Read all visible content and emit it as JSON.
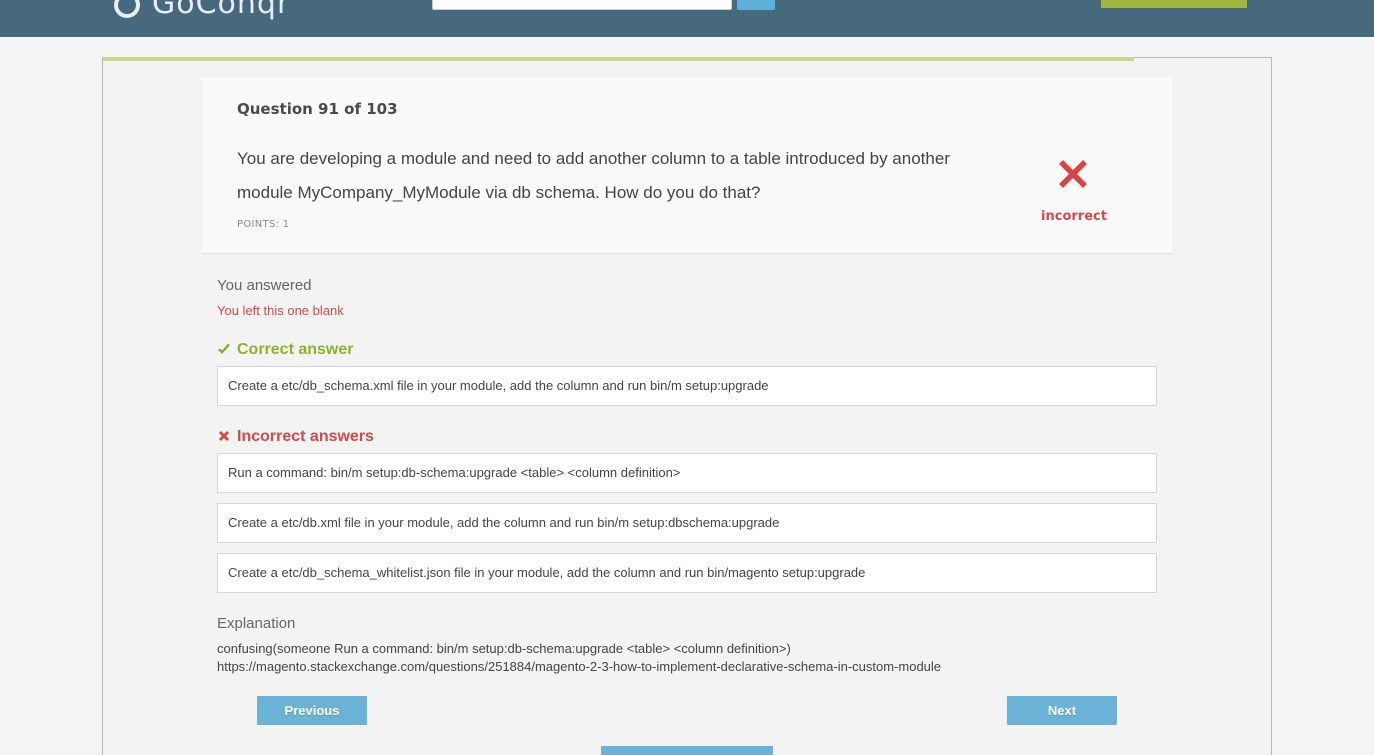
{
  "header": {
    "logo_text": "GoConqr"
  },
  "question": {
    "number_label": "Question 91 of 103",
    "text": "You are developing a module and need to add another column to a table introduced by another module MyCompany_MyModule via db schema. How do you do that?",
    "points": "POINTS: 1",
    "result_label": "incorrect",
    "result_icon": "x-icon"
  },
  "answers": {
    "you_answered_title": "You answered",
    "you_answered_value": "You left this one blank",
    "correct_heading": "Correct answer",
    "correct": [
      "Create a etc/db_schema.xml file in your module, add the column and run bin/m setup:upgrade"
    ],
    "incorrect_heading": "Incorrect answers",
    "incorrect": [
      "Run a command: bin/m setup:db-schema:upgrade <table> <column definition>",
      "Create a etc/db.xml file in your module, add the column and run bin/m setup:dbschema:upgrade",
      "Create a etc/db_schema_whitelist.json file in your module, add the column and run bin/magento setup:upgrade"
    ]
  },
  "explanation": {
    "title": "Explanation",
    "line1": "confusing(someone Run a command: bin/m setup:db-schema:upgrade <table> <column definition>)",
    "line2": "https://magento.stackexchange.com/questions/251884/magento-2-3-how-to-implement-declarative-schema-in-custom-module"
  },
  "navigation": {
    "previous_label": "Previous",
    "next_label": "Next"
  },
  "colors": {
    "header": "#46697e",
    "correct": "#8fb02c",
    "incorrect": "#d44a4a",
    "button": "#6bb3d6"
  }
}
